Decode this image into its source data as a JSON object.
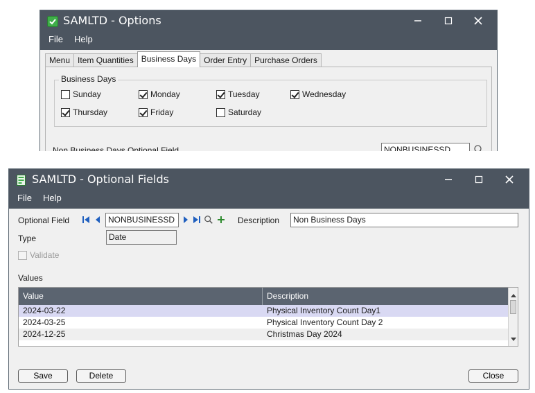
{
  "options_window": {
    "title": "SAMLTD - Options",
    "menu": [
      "File",
      "Help"
    ],
    "tabs": [
      {
        "label": "Menu",
        "active": false
      },
      {
        "label": "Item Quantities",
        "active": false
      },
      {
        "label": "Business Days",
        "active": true
      },
      {
        "label": "Order Entry",
        "active": false
      },
      {
        "label": "Purchase Orders",
        "active": false
      }
    ],
    "business_days": {
      "legend": "Business Days",
      "days": [
        {
          "label": "Sunday",
          "checked": false
        },
        {
          "label": "Monday",
          "checked": true
        },
        {
          "label": "Tuesday",
          "checked": true
        },
        {
          "label": "Wednesday",
          "checked": true
        },
        {
          "label": "Thursday",
          "checked": true
        },
        {
          "label": "Friday",
          "checked": true
        },
        {
          "label": "Saturday",
          "checked": false
        }
      ]
    },
    "non_business_field": {
      "label": "Non Business Days Optional Field",
      "value": "NONBUSINESSD"
    }
  },
  "optional_fields_window": {
    "title": "SAMLTD - Optional Fields",
    "menu": [
      "File",
      "Help"
    ],
    "optional_field_label": "Optional Field",
    "optional_field_value": "NONBUSINESSD",
    "description_label": "Description",
    "description_value": "Non Business Days",
    "type_label": "Type",
    "type_value": "Date",
    "validate_label": "Validate",
    "validate_checked": false,
    "values_label": "Values",
    "columns": [
      "Value",
      "Description"
    ],
    "rows": [
      {
        "value": "2024-03-22",
        "description": "Physical Inventory Count Day1"
      },
      {
        "value": "2024-03-25",
        "description": "Physical Inventory Count Day 2"
      },
      {
        "value": "2024-12-25",
        "description": "Christmas Day 2024"
      }
    ],
    "buttons": {
      "save": "Save",
      "delete": "Delete",
      "close": "Close"
    }
  },
  "colors": {
    "titlebar": "#4c5560",
    "grid_header": "#5b6470",
    "selected_row": "#d9d9f3",
    "nav_blue": "#1f5fbf",
    "add_green": "#2e8b2e"
  },
  "icons": {
    "options_app": "green-shield-icon",
    "optfields_app": "green-document-icon",
    "finder": "magnifier-icon",
    "add": "plus-icon"
  }
}
